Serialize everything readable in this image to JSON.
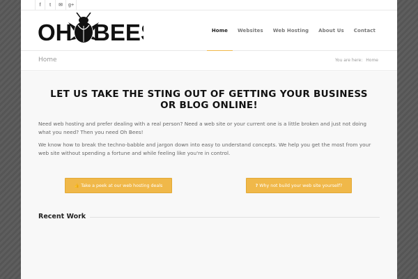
{
  "social": [
    {
      "icon": "facebook-icon",
      "glyph": "f"
    },
    {
      "icon": "twitter-icon",
      "glyph": "t"
    },
    {
      "icon": "mail-icon",
      "glyph": "✉"
    },
    {
      "icon": "google-plus-icon",
      "glyph": "g+"
    }
  ],
  "logo": {
    "left_text": "OH",
    "right_text": "BEES"
  },
  "nav": {
    "items": [
      {
        "label": "Home",
        "active": true
      },
      {
        "label": "Websites"
      },
      {
        "label": "Web Hosting"
      },
      {
        "label": "About Us"
      },
      {
        "label": "Contact"
      }
    ]
  },
  "titlebar": {
    "title": "Home",
    "breadcrumb_prefix": "You are here:",
    "breadcrumb_current": "Home"
  },
  "content": {
    "headline": "LET US TAKE THE STING OUT OF GETTING YOUR BUSINESS OR BLOG ONLINE!",
    "paragraph1": "Need web hosting and prefer dealing with a real person? Need a web site or your current one is a little broken and just not doing what you need? Then you need Oh Bees!",
    "paragraph2": "We know how to break the techno-babble and jargon down into easy to understand concepts. We help you get the most from your web site without spending a fortune and while feeling like you're in control.",
    "button_left": {
      "icon": "thumbs-up-icon",
      "glyph": "👍",
      "label": "Take a peek at our web hosting deals"
    },
    "button_right": {
      "icon": "question-icon",
      "glyph": "?",
      "label": "Why not build your web site yourself?"
    },
    "recent_title": "Recent Work"
  },
  "colors": {
    "accent": "#f0b849",
    "background": "#585858",
    "content_bg": "#f8f8f8"
  }
}
